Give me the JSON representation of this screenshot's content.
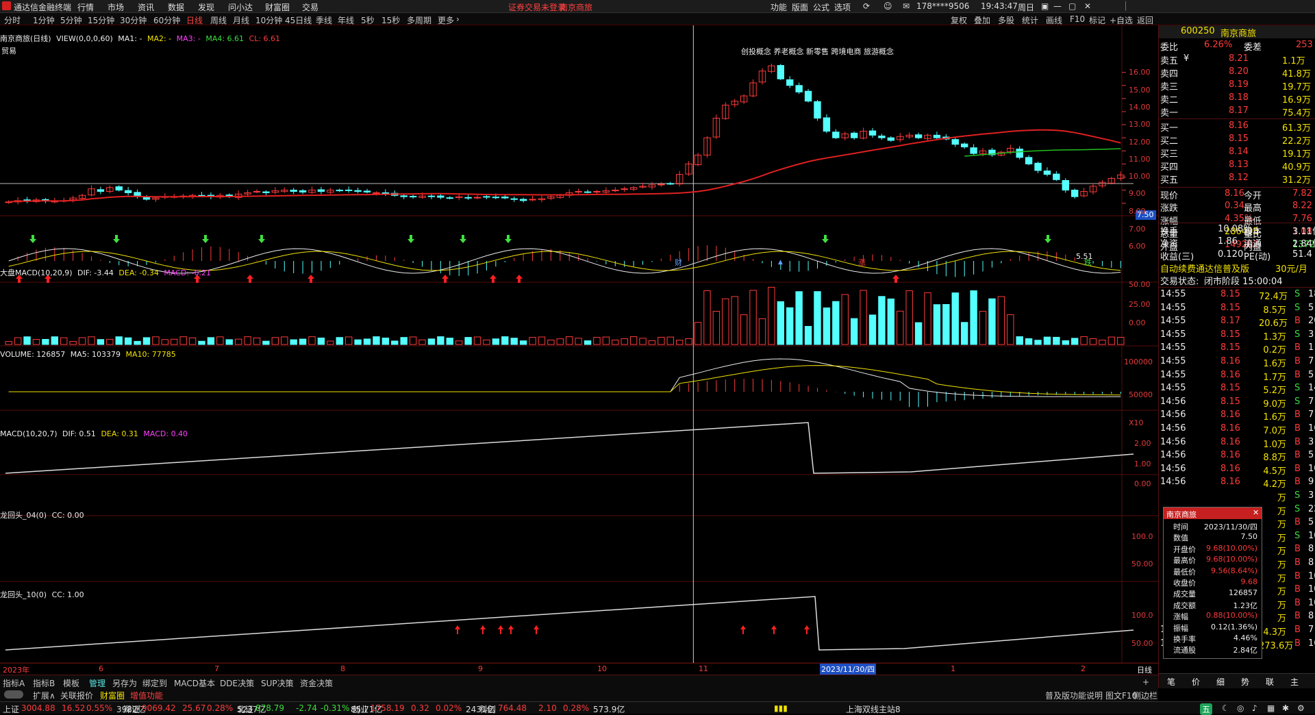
{
  "app": {
    "name": "通达信金融终端",
    "top_menu": [
      "行情",
      "市场",
      "资讯",
      "数据",
      "发现",
      "问小达",
      "财富圈",
      "交易"
    ],
    "notice": "证券交易未登录",
    "notice_stock": "南京商旅",
    "right_menu": [
      "功能",
      "版面",
      "公式",
      "选项"
    ],
    "account": "178****9506",
    "time": "19:43:47",
    "weekday": "周日",
    "colors": {
      "up": "#ff3b3b",
      "down": "#54ffff",
      "bg": "#000000"
    }
  },
  "period_bar": {
    "items": [
      "分时",
      "1分钟",
      "5分钟",
      "15分钟",
      "30分钟",
      "60分钟",
      "日线",
      "周线",
      "月线",
      "10分钟",
      "45日线",
      "季线",
      "年线",
      "5秒",
      "15秒",
      "多周期",
      "更多"
    ],
    "active": "日线",
    "tools": [
      "复权",
      "叠加",
      "多股",
      "统计",
      "画线",
      "F10",
      "标记",
      "+自选",
      "返回"
    ]
  },
  "main_panel": {
    "header": "南京商旅(日线)",
    "view": "VIEW(0,0,0,60)",
    "ma1": "MA1: -",
    "ma2": "MA2: -",
    "ma3": "MA3: -",
    "ma4": "MA4: 6.61",
    "cl": "CL: 6.61",
    "sector": "贸易",
    "concepts": "创投概念 养老概念 新零售 跨境电商 旅游概念",
    "low_label": "5.51",
    "cur_tag": "7.50",
    "yaxis": [
      "16.00",
      "15.00",
      "14.00",
      "13.00",
      "12.00",
      "11.00",
      "10.00",
      "9.00",
      "8.00",
      "7.00",
      "6.00"
    ],
    "marks": [
      "财",
      "▲",
      "涨",
      "跌"
    ]
  },
  "macd_big": {
    "header": "大盘MACD(10,20,9)",
    "dif": "DIF: -3.44",
    "dea": "DEA: -0.34",
    "macd": "MACD: -6.21",
    "yaxis": [
      "50.00",
      "25.00",
      "0.00"
    ]
  },
  "volume": {
    "header": "VOLUME: 126857",
    "ma5": "MA5: 103379",
    "ma10": "MA10: 77785",
    "yaxis": [
      "100000",
      "50000",
      "X10"
    ]
  },
  "macd": {
    "header": "MACD(10,20,7)",
    "dif": "DIF: 0.51",
    "dea": "DEA: 0.31",
    "macd": "MACD: 0.40",
    "yaxis": [
      "2.00",
      "1.00",
      "0.00"
    ]
  },
  "lht04": {
    "header": "龙回头_04(0)",
    "cc": "CC: 0.00",
    "yaxis": [
      "100.0",
      "50.00"
    ]
  },
  "lht10": {
    "header": "龙回头_10(0)",
    "cc": "CC: 1.00",
    "yaxis": [
      "100.0",
      "50.00"
    ]
  },
  "date_axis": {
    "labels": [
      "2023年",
      "6",
      "7",
      "8",
      "9",
      "10",
      "11",
      "2023/11/30/四",
      "1",
      "2"
    ],
    "mode": "日线"
  },
  "quote": {
    "code": "600250",
    "name": "南京商旅",
    "weibi_label": "委比",
    "weibi": "6.26%",
    "weicha_label": "委差",
    "weicha": "253",
    "asks": [
      {
        "label": "卖五",
        "flag": "¥",
        "price": "8.21",
        "vol": "1.1万"
      },
      {
        "label": "卖四",
        "flag": "",
        "price": "8.20",
        "vol": "41.8万"
      },
      {
        "label": "卖三",
        "flag": "",
        "price": "8.19",
        "vol": "19.7万"
      },
      {
        "label": "卖二",
        "flag": "",
        "price": "8.18",
        "vol": "16.9万"
      },
      {
        "label": "卖一",
        "flag": "",
        "price": "8.17",
        "vol": "75.4万"
      }
    ],
    "bids": [
      {
        "label": "买一",
        "price": "8.16",
        "vol": "61.3万"
      },
      {
        "label": "买二",
        "price": "8.15",
        "vol": "22.2万"
      },
      {
        "label": "买三",
        "price": "8.14",
        "vol": "19.1万"
      },
      {
        "label": "买四",
        "price": "8.13",
        "vol": "40.9万"
      },
      {
        "label": "买五",
        "price": "8.12",
        "vol": "31.2万"
      }
    ],
    "stats": [
      {
        "l1": "现价",
        "v1": "8.16",
        "l2": "今开",
        "v2": "7.82"
      },
      {
        "l1": "涨跌",
        "v1": "0.34",
        "l2": "最高",
        "v2": "8.22"
      },
      {
        "l1": "涨幅",
        "v1": "4.35%",
        "l2": "最低",
        "v2": "7.76"
      },
      {
        "l1": "总量",
        "v1": "286495",
        "l2": "量比",
        "v2": "1.08"
      },
      {
        "l1": "外盘",
        "v1": "149202",
        "l2": "内盘",
        "v2": "137293"
      }
    ],
    "stats2": [
      {
        "l1": "换手",
        "v1": "10.08%",
        "l2": "股本",
        "v2": "3.11亿"
      },
      {
        "l1": "净资",
        "v1": "1.86",
        "l2": "流通",
        "v2": "2.84亿"
      },
      {
        "l1": "收益(三)",
        "v1": "0.120",
        "l2": "PE(动)",
        "v2": "51.4"
      }
    ],
    "promo": "自动续费通达信普及版",
    "promo_price": "30元/月",
    "trade_state_label": "交易状态:",
    "trade_state": "闭市阶段 15:00:04"
  },
  "ticks": [
    {
      "t": "14:55",
      "p": "8.15",
      "v": "72.4万",
      "d": "S",
      "n": "18"
    },
    {
      "t": "14:55",
      "p": "8.15",
      "v": "8.5万",
      "d": "S",
      "n": "5"
    },
    {
      "t": "14:55",
      "p": "8.17",
      "v": "20.6万",
      "d": "B",
      "n": "20"
    },
    {
      "t": "14:55",
      "p": "8.15",
      "v": "1.3万",
      "d": "S",
      "n": "3"
    },
    {
      "t": "14:55",
      "p": "8.15",
      "v": "0.2万",
      "d": "B",
      "n": "1"
    },
    {
      "t": "14:55",
      "p": "8.16",
      "v": "1.6万",
      "d": "B",
      "n": "7"
    },
    {
      "t": "14:55",
      "p": "8.16",
      "v": "1.7万",
      "d": "B",
      "n": "5"
    },
    {
      "t": "14:55",
      "p": "8.15",
      "v": "5.2万",
      "d": "S",
      "n": "14"
    },
    {
      "t": "14:56",
      "p": "8.15",
      "v": "9.0万",
      "d": "S",
      "n": "7"
    },
    {
      "t": "14:56",
      "p": "8.16",
      "v": "1.6万",
      "d": "B",
      "n": "7"
    },
    {
      "t": "14:56",
      "p": "8.16",
      "v": "7.0万",
      "d": "B",
      "n": "16"
    },
    {
      "t": "14:56",
      "p": "8.16",
      "v": "1.0万",
      "d": "B",
      "n": "3"
    },
    {
      "t": "14:56",
      "p": "8.16",
      "v": "8.8万",
      "d": "B",
      "n": "5"
    },
    {
      "t": "14:56",
      "p": "8.16",
      "v": "4.5万",
      "d": "B",
      "n": "10"
    },
    {
      "t": "14:56",
      "p": "8.16",
      "v": "4.2万",
      "d": "B",
      "n": "9"
    },
    {
      "t": "",
      "p": "",
      "v": "万",
      "d": "S",
      "n": "3"
    },
    {
      "t": "",
      "p": "",
      "v": "万",
      "d": "S",
      "n": "22"
    },
    {
      "t": "",
      "p": "",
      "v": "万",
      "d": "B",
      "n": "5"
    },
    {
      "t": "",
      "p": "",
      "v": "万",
      "d": "S",
      "n": "10"
    },
    {
      "t": "",
      "p": "",
      "v": "万",
      "d": "B",
      "n": "8"
    },
    {
      "t": "",
      "p": "",
      "v": "万",
      "d": "B",
      "n": "8"
    },
    {
      "t": "",
      "p": "",
      "v": "万",
      "d": "B",
      "n": "10"
    },
    {
      "t": "",
      "p": "",
      "v": "万",
      "d": "B",
      "n": "10"
    },
    {
      "t": "",
      "p": "",
      "v": "万",
      "d": "B",
      "n": "10"
    },
    {
      "t": "",
      "p": "",
      "v": "万",
      "d": "B",
      "n": "8"
    },
    {
      "t": "14:57",
      "p": "8.16",
      "v": "4.3万",
      "d": "B",
      "n": "7"
    },
    {
      "t": "15:00",
      "p": "8.16",
      "v": "273.6万",
      "d": "B",
      "n": "167"
    }
  ],
  "popup": {
    "title": "南京商旅",
    "rows": [
      {
        "k": "时间",
        "v": "2023/11/30/四",
        "c": "white"
      },
      {
        "k": "数值",
        "v": "7.50",
        "c": "white"
      },
      {
        "k": "开盘价",
        "v": "9.68(10.00%)",
        "c": "red"
      },
      {
        "k": "最高价",
        "v": "9.68(10.00%)",
        "c": "red"
      },
      {
        "k": "最低价",
        "v": "9.56(8.64%)",
        "c": "red"
      },
      {
        "k": "收盘价",
        "v": "9.68",
        "c": "red"
      },
      {
        "k": "成交量",
        "v": "126857",
        "c": "white"
      },
      {
        "k": "成交额",
        "v": "1.23亿",
        "c": "white"
      },
      {
        "k": "涨幅",
        "v": "0.88(10.00%)",
        "c": "red"
      },
      {
        "k": "振幅",
        "v": "0.12(1.36%)",
        "c": "white"
      },
      {
        "k": "换手率",
        "v": "4.46%",
        "c": "white"
      },
      {
        "k": "流通股",
        "v": "2.84亿",
        "c": "white"
      }
    ]
  },
  "bottom_tabs": [
    "指标A",
    "指标B",
    "模板",
    "管理",
    "另存为",
    "绑定到",
    "MACD基本",
    "DDE决策",
    "SUP决策",
    "资金决策"
  ],
  "bottom_tabs2": [
    "扩展∧",
    "关联报价",
    "财富圈",
    "增值功能"
  ],
  "bottom_right": [
    "普及版功能说明",
    "图文F10",
    "侧边栏"
  ],
  "side_tabs": [
    "笔",
    "价",
    "细",
    "势",
    "联",
    "主"
  ],
  "status": {
    "items": [
      {
        "k": "上证",
        "v": "3004.88",
        "c": "16.52",
        "p": "0.55%",
        "a": "3982亿"
      },
      {
        "k": "深证",
        "v": "9069.42",
        "c": "25.67",
        "p": "0.28%",
        "a": "5237亿"
      },
      {
        "k": "北证",
        "v": "878.79",
        "c": "-2.74",
        "p": "-0.31%",
        "a": "85.71亿"
      },
      {
        "k": "创业",
        "v": "1758.19",
        "c": "0.32",
        "p": "0.02%",
        "a": "2431亿"
      },
      {
        "k": "科创",
        "v": "764.48",
        "c": "2.10",
        "p": "0.28%",
        "a": "573.9亿"
      }
    ],
    "server": "上海双线主站8"
  },
  "chart_data": {
    "type": "candlestick",
    "title": "南京商旅(日线)",
    "ylim": [
      5.2,
      17.5
    ],
    "x_labels": [
      "2023年",
      "6",
      "7",
      "8",
      "9",
      "10",
      "11",
      "2023/11/30/四",
      "1",
      "2"
    ],
    "closes": [
      6.1,
      6.2,
      6.15,
      6.25,
      6.2,
      6.15,
      6.2,
      6.4,
      6.6,
      7.1,
      6.9,
      7.2,
      7.0,
      6.8,
      6.5,
      6.3,
      6.4,
      6.5,
      6.5,
      6.55,
      6.6,
      6.55,
      6.5,
      6.6,
      6.5,
      6.7,
      6.8,
      6.9,
      6.8,
      6.95,
      7.0,
      6.9,
      6.85,
      7.0,
      6.9,
      7.0,
      6.95,
      7.0,
      6.9,
      6.85,
      6.8,
      6.7,
      6.6,
      6.5,
      6.5,
      6.55,
      6.5,
      6.45,
      6.4,
      6.5,
      6.4,
      6.45,
      6.5,
      6.45,
      6.4,
      6.3,
      6.2,
      6.3,
      6.35,
      6.5,
      6.6,
      6.8,
      6.9,
      6.85,
      6.9,
      6.95,
      7.0,
      7.1,
      7.2,
      7.3,
      7.4,
      7.45,
      7.5,
      8.2,
      9.0,
      9.68,
      11.0,
      12.5,
      13.5,
      13.8,
      14.2,
      15.2,
      16.1,
      16.5,
      15.5,
      15.0,
      14.5,
      13.8,
      12.5,
      11.5,
      11.0,
      11.3,
      11.0,
      11.5,
      11.2,
      11.0,
      10.8,
      11.1,
      11.2,
      11.0,
      11.2,
      11.0,
      10.9,
      10.5,
      10.3,
      9.8,
      10.0,
      9.7,
      9.9,
      10.2,
      9.5,
      9.0,
      8.5,
      8.2,
      7.8,
      7.0,
      6.5,
      6.9,
      7.3,
      7.6,
      7.9,
      8.16
    ]
  }
}
